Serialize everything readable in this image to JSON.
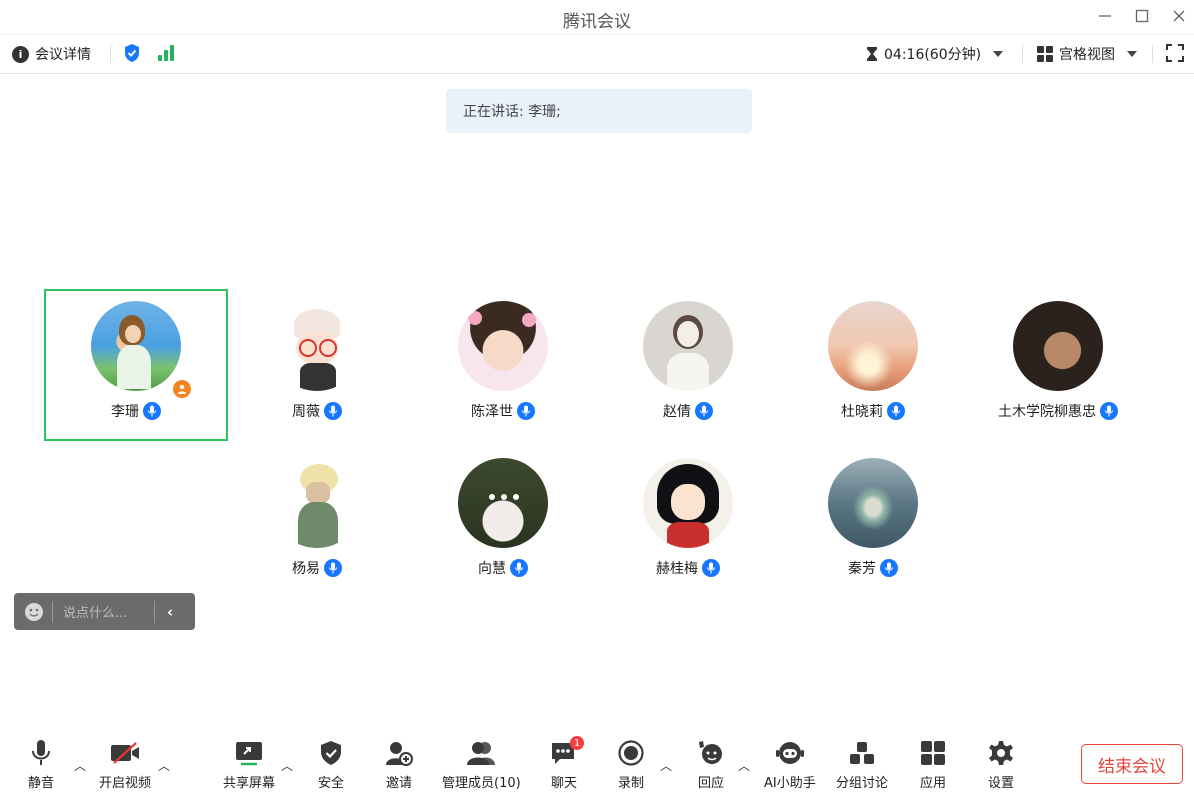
{
  "window": {
    "title": "腾讯会议"
  },
  "infobar": {
    "details_label": "会议详情",
    "timer": "04:16(60分钟)",
    "view_label": "宫格视图"
  },
  "speaking_banner": "正在讲话: 李珊;",
  "participants": [
    {
      "name": "李珊",
      "host": true,
      "active_speaker": true,
      "avatar": "anime-girl-blue-sky"
    },
    {
      "name": "周薇",
      "avatar": "cartoon-girl-glasses"
    },
    {
      "name": "陈泽世",
      "avatar": "child-photo"
    },
    {
      "name": "赵倩",
      "avatar": "girl-sketch"
    },
    {
      "name": "杜晓莉",
      "avatar": "sunset-sky"
    },
    {
      "name": "土木学院柳惠忠",
      "avatar": "man-photo"
    },
    {
      "name": "杨易",
      "avatar": "anime-character-mask"
    },
    {
      "name": "向慧",
      "avatar": "woman-with-flowers"
    },
    {
      "name": "赫桂梅",
      "avatar": "anime-boy-black-hair"
    },
    {
      "name": "秦芳",
      "avatar": "aerial-island"
    }
  ],
  "chat": {
    "placeholder": "说点什么..."
  },
  "toolbar": {
    "mute": "静音",
    "video": "开启视频",
    "share": "共享屏幕",
    "security": "安全",
    "invite": "邀请",
    "members": "管理成员(10)",
    "chat": "聊天",
    "chat_badge": "1",
    "record": "录制",
    "reactions": "回应",
    "ai": "AI小助手",
    "breakout": "分组讨论",
    "apps": "应用",
    "settings": "设置",
    "end": "结束会议"
  },
  "colors": {
    "accent": "#1677ff",
    "active_border": "#2ec25e",
    "end_red": "#e0453a",
    "host_orange": "#f5841f"
  }
}
